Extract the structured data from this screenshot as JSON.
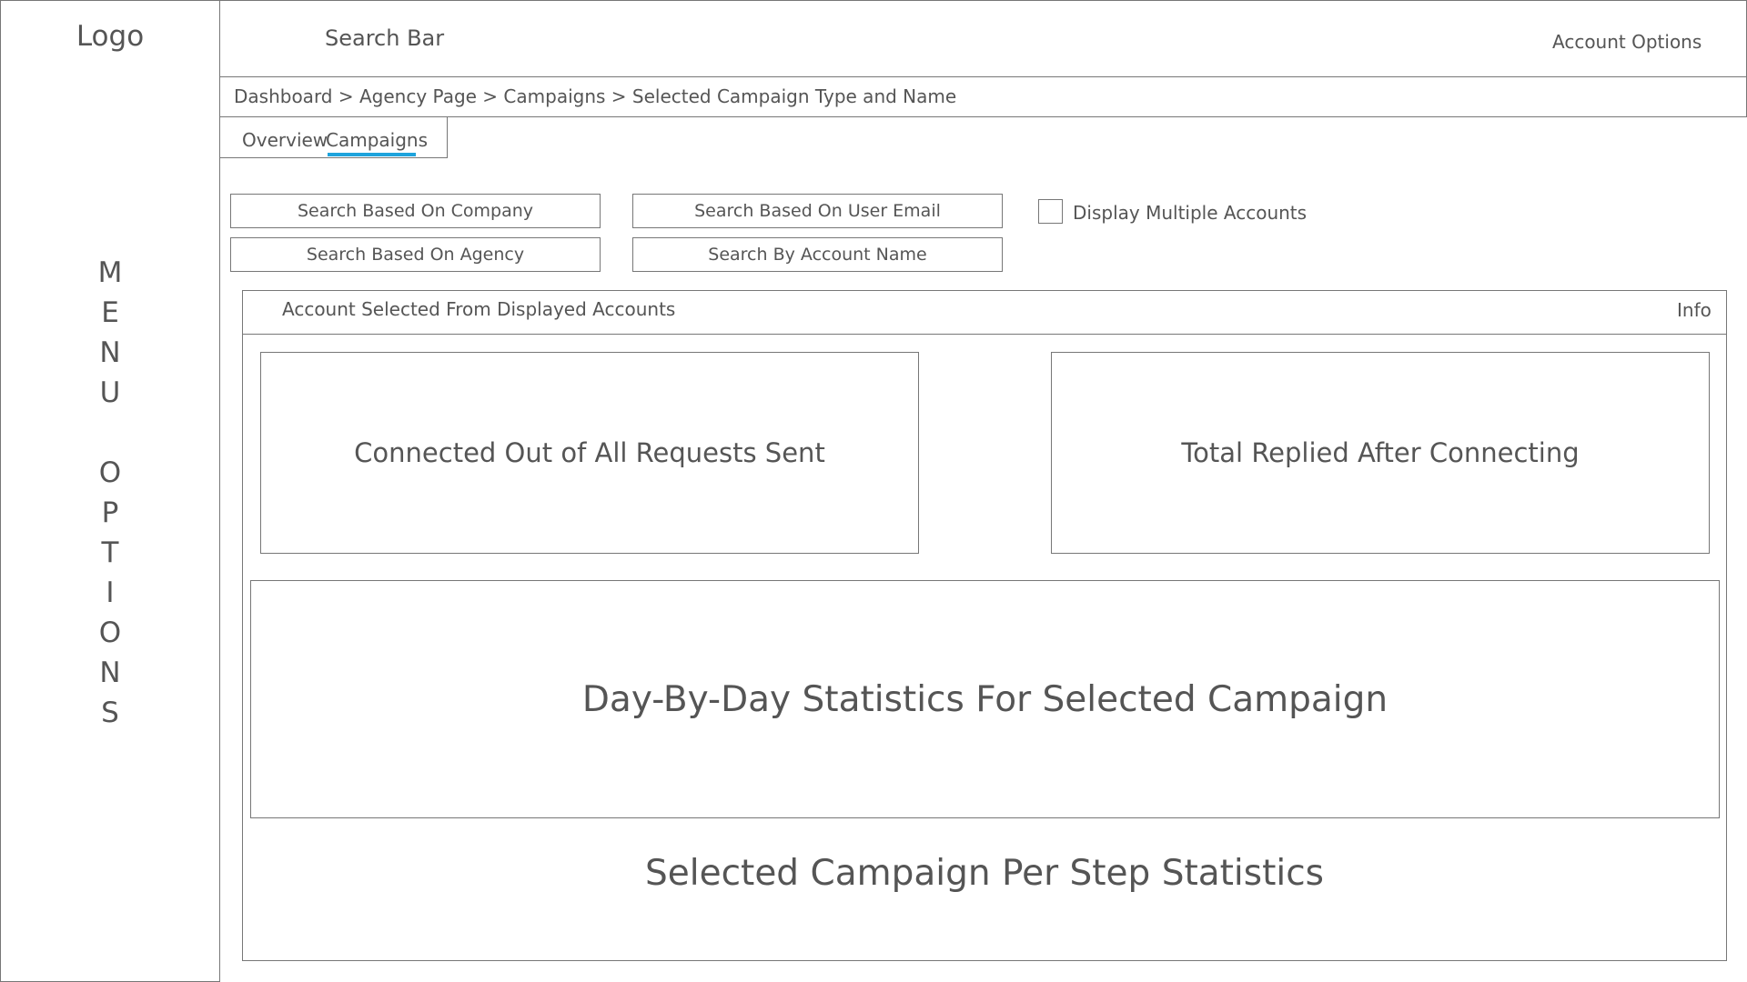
{
  "sidebar": {
    "logo": "Logo",
    "menu_letters_line1": [
      "M",
      "E",
      "N",
      "U"
    ],
    "menu_letters_line2": [
      "O",
      "P",
      "T",
      "I",
      "O",
      "N",
      "S"
    ]
  },
  "header": {
    "search_bar": "Search Bar",
    "account_options": "Account Options"
  },
  "breadcrumb": {
    "text": "Dashboard > Agency Page > Campaigns > Selected Campaign Type and Name"
  },
  "tabs": {
    "overview": "Overview",
    "campaigns": "Campaigns"
  },
  "filters": {
    "company": "Search Based On Company",
    "user_email": "Search Based On User Email",
    "agency": "Search Based On Agency",
    "account_name": "Search By Account Name",
    "display_multiple": "Display Multiple Accounts"
  },
  "panel": {
    "account_selected": "Account Selected From Displayed Accounts",
    "info": "Info",
    "connected": "Connected Out of All Requests Sent",
    "replied": "Total Replied After Connecting",
    "daily_stats": "Day-By-Day Statistics For Selected Campaign",
    "per_step_stats": "Selected Campaign Per Step Statistics"
  },
  "colors": {
    "accent_underline": "#1ea3dc",
    "border": "#777777",
    "text": "#555555"
  }
}
